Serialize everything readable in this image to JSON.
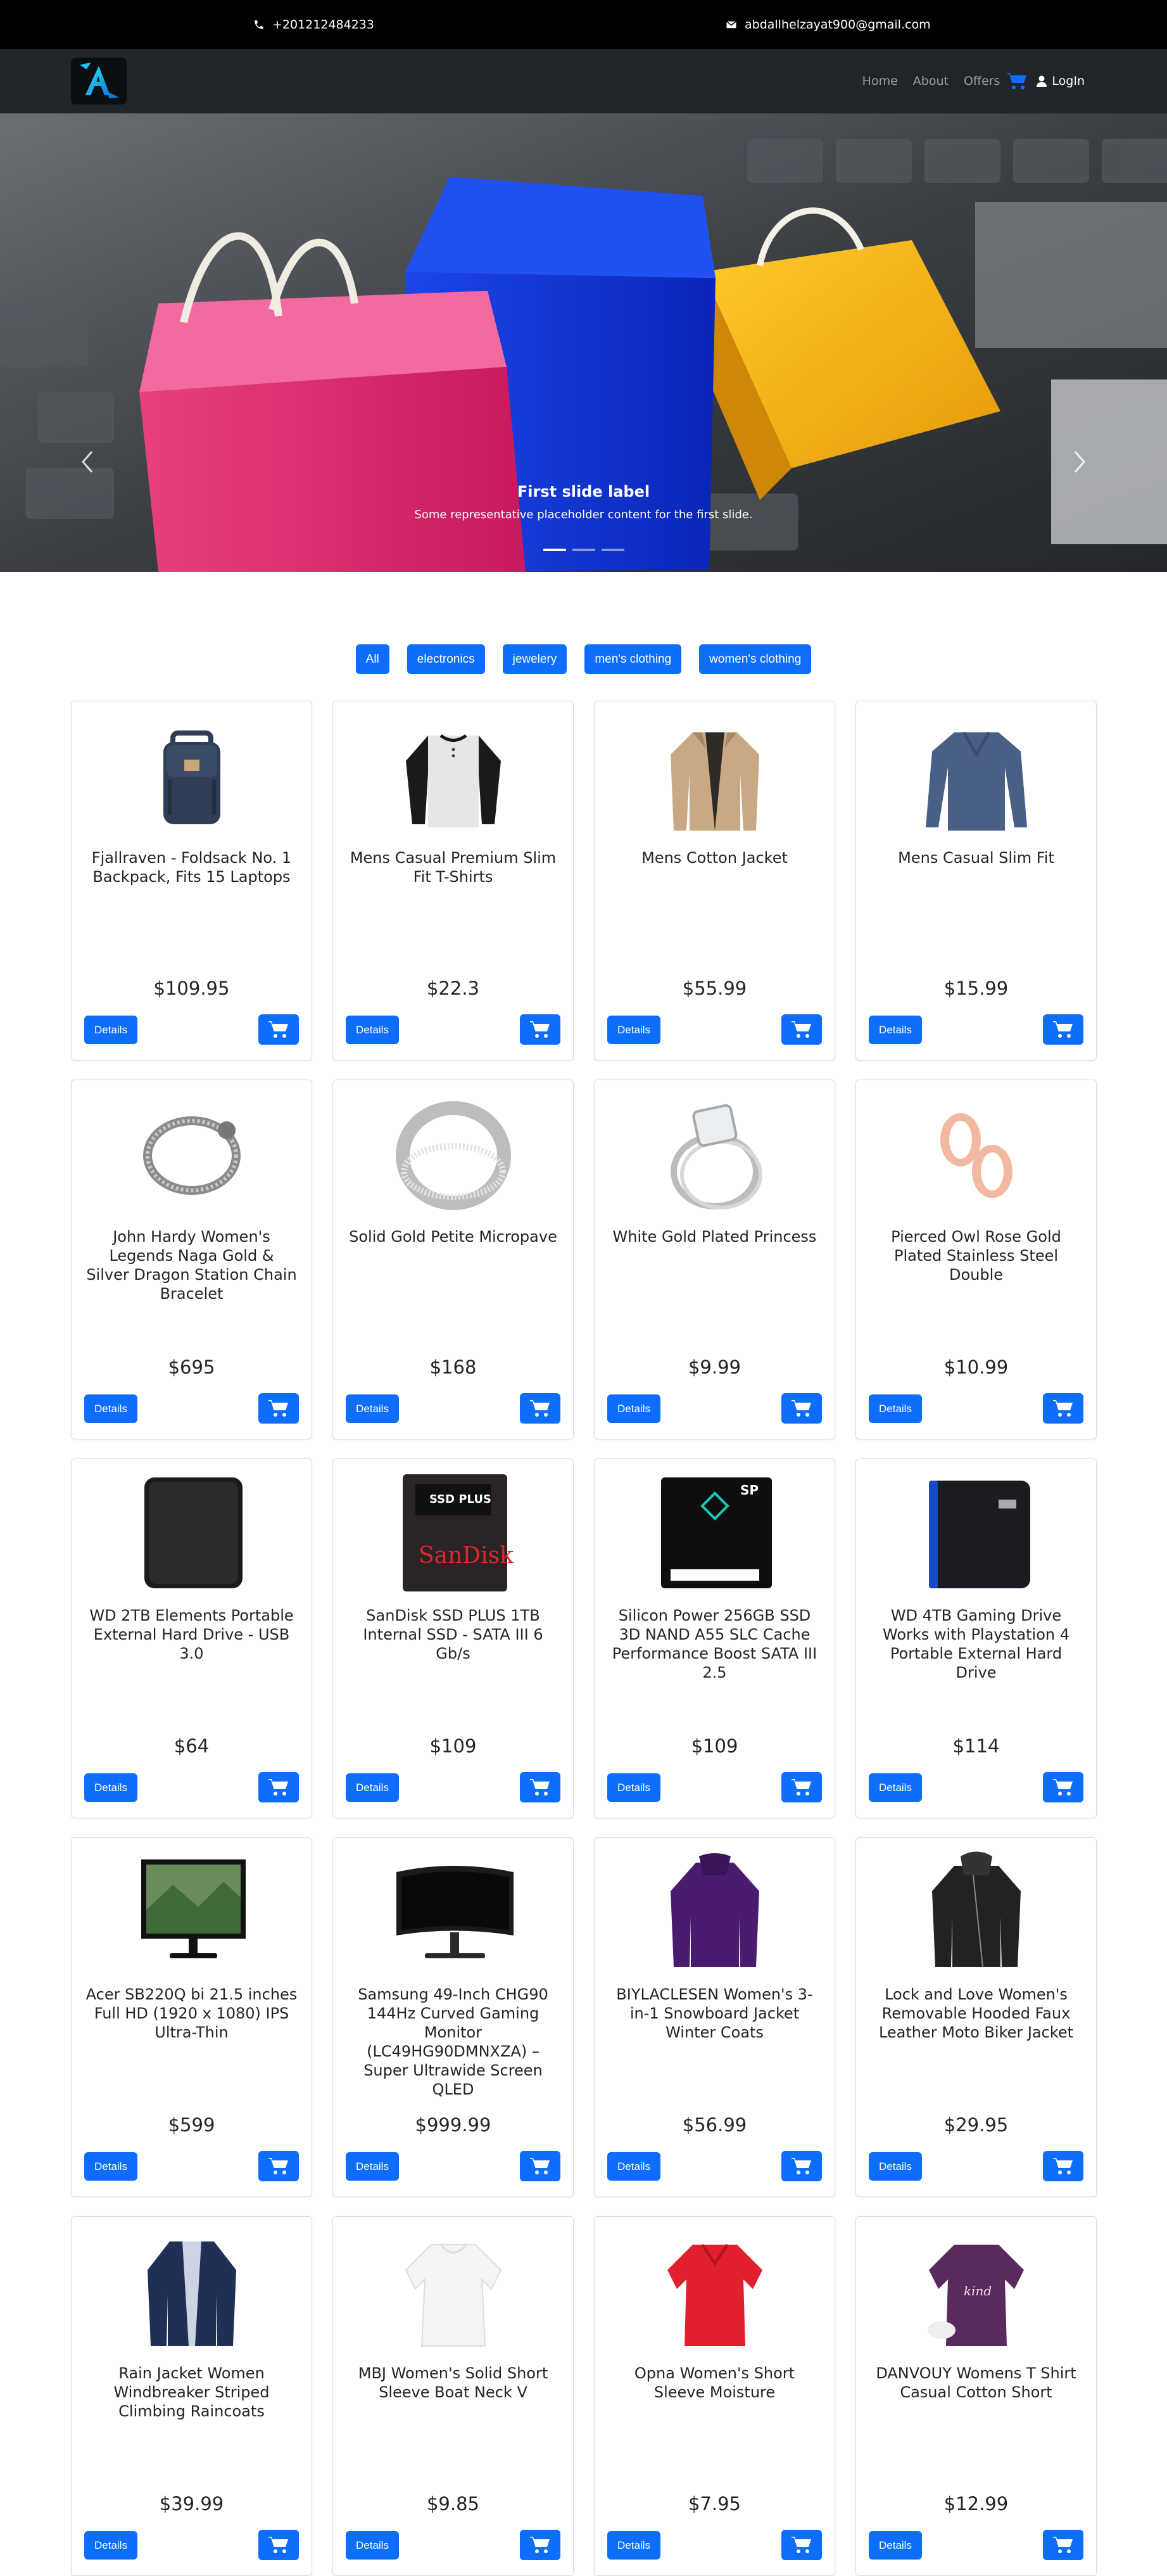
{
  "contact": {
    "phone": "+201212484233",
    "email": "abdallhelzayat900@gmail.com"
  },
  "nav": {
    "links": [
      "Home",
      "About",
      "Offers"
    ],
    "login": "LogIn"
  },
  "carousel": {
    "caption_title": "First slide label",
    "caption_text": "Some representative placeholder content for the first slide.",
    "slides_total": 3,
    "active_slide": 1
  },
  "filters": [
    "All",
    "electronics",
    "jewelery",
    "men's clothing",
    "women's clothing"
  ],
  "buttons": {
    "details": "Details"
  },
  "products": [
    {
      "title": "Fjallraven - Foldsack No. 1 Backpack, Fits 15 Laptops",
      "price": "$109.95",
      "icon": "backpack"
    },
    {
      "title": "Mens Casual Premium Slim Fit T-Shirts",
      "price": "$22.3",
      "icon": "raglan-tshirt"
    },
    {
      "title": "Mens Cotton Jacket",
      "price": "$55.99",
      "icon": "cotton-jacket"
    },
    {
      "title": "Mens Casual Slim Fit",
      "price": "$15.99",
      "icon": "long-sleeve-shirt"
    },
    {
      "title": "John Hardy Women's Legends Naga Gold & Silver Dragon Station Chain Bracelet",
      "price": "$695",
      "icon": "bracelet"
    },
    {
      "title": "Solid Gold Petite Micropave",
      "price": "$168",
      "icon": "ring"
    },
    {
      "title": "White Gold Plated Princess",
      "price": "$9.99",
      "icon": "diamond-ring"
    },
    {
      "title": "Pierced Owl Rose Gold Plated Stainless Steel Double",
      "price": "$10.99",
      "icon": "rose-gold-tunnels"
    },
    {
      "title": "WD 2TB Elements Portable External Hard Drive - USB 3.0",
      "price": "$64",
      "icon": "hard-drive"
    },
    {
      "title": "SanDisk SSD PLUS 1TB Internal SSD - SATA III 6 Gb/s",
      "price": "$109",
      "icon": "sandisk-ssd"
    },
    {
      "title": "Silicon Power 256GB SSD 3D NAND A55 SLC Cache Performance Boost SATA III 2.5",
      "price": "$109",
      "icon": "silicon-power-ssd"
    },
    {
      "title": "WD 4TB Gaming Drive Works with Playstation 4 Portable External Hard Drive",
      "price": "$114",
      "icon": "gaming-drive"
    },
    {
      "title": "Acer SB220Q bi 21.5 inches Full HD (1920 x 1080) IPS Ultra-Thin",
      "price": "$599",
      "icon": "monitor"
    },
    {
      "title": "Samsung 49-Inch CHG90 144Hz Curved Gaming Monitor (LC49HG90DMNXZA) – Super Ultrawide Screen QLED",
      "price": "$999.99",
      "icon": "curved-monitor"
    },
    {
      "title": "BIYLACLESEN Women's 3-in-1 Snowboard Jacket Winter Coats",
      "price": "$56.99",
      "icon": "snowboard-jacket"
    },
    {
      "title": "Lock and Love Women's Removable Hooded Faux Leather Moto Biker Jacket",
      "price": "$29.95",
      "icon": "leather-jacket"
    },
    {
      "title": "Rain Jacket Women Windbreaker Striped Climbing Raincoats",
      "price": "$39.99",
      "icon": "rain-jacket"
    },
    {
      "title": "MBJ Women's Solid Short Sleeve Boat Neck V",
      "price": "$9.85",
      "icon": "white-top"
    },
    {
      "title": "Opna Women's Short Sleeve Moisture",
      "price": "$7.95",
      "icon": "red-tshirt"
    },
    {
      "title": "DANVOUY Womens T Shirt Casual Cotton Short",
      "price": "$12.99",
      "icon": "purple-tshirt"
    }
  ],
  "colors": {
    "primary": "#0d6efd",
    "topbar": "#000000",
    "navbar": "#212529"
  }
}
